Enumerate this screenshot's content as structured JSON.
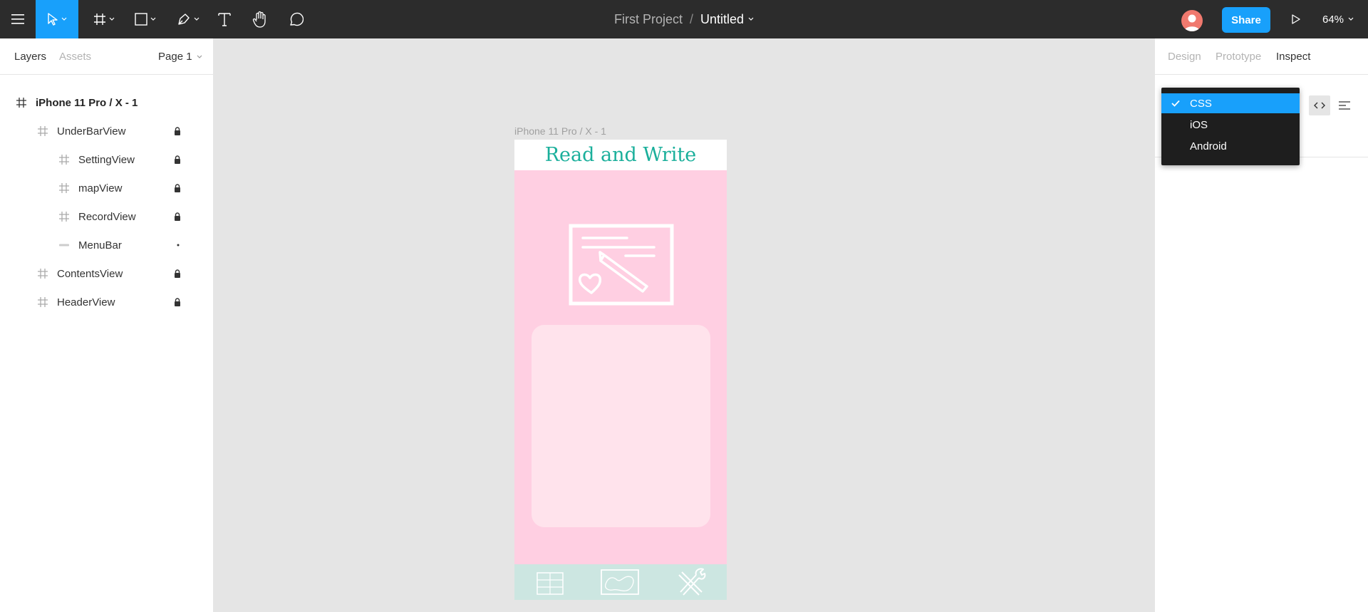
{
  "toolbar": {
    "project_name": "First Project",
    "separator": "/",
    "file_name": "Untitled",
    "share_label": "Share",
    "zoom": "64%",
    "tools": [
      "menu-icon",
      "move-tool-icon",
      "frame-tool-icon",
      "shape-tool-icon",
      "pen-tool-icon",
      "text-tool-icon",
      "hand-tool-icon",
      "comment-tool-icon"
    ]
  },
  "left_panel": {
    "tabs": [
      "Layers",
      "Assets"
    ],
    "page": "Page 1",
    "layers": [
      {
        "name": "iPhone 11 Pro / X - 1",
        "depth": 0,
        "type": "frame",
        "locked": false,
        "bold": true
      },
      {
        "name": "UnderBarView",
        "depth": 1,
        "type": "frame",
        "locked": true
      },
      {
        "name": "SettingView",
        "depth": 2,
        "type": "frame",
        "locked": true
      },
      {
        "name": "mapView",
        "depth": 2,
        "type": "frame",
        "locked": true
      },
      {
        "name": "RecordView",
        "depth": 2,
        "type": "frame",
        "locked": true
      },
      {
        "name": "MenuBar",
        "depth": 2,
        "type": "rect",
        "locked": false
      },
      {
        "name": "ContentsView",
        "depth": 1,
        "type": "frame",
        "locked": true
      },
      {
        "name": "HeaderView",
        "depth": 1,
        "type": "frame",
        "locked": true
      }
    ]
  },
  "right_panel": {
    "tabs": [
      "Design",
      "Prototype",
      "Inspect"
    ],
    "active_tab": "Inspect",
    "code_options": [
      "CSS",
      "iOS",
      "Android"
    ],
    "selected_option": "CSS"
  },
  "canvas": {
    "frame_label": "iPhone 11 Pro / X - 1",
    "header_text": "Read and Write"
  },
  "colors": {
    "toolbar_bg": "#2c2c2c",
    "accent": "#18a0fb",
    "header_text": "#1aaf9b",
    "phone_bg": "#ffcfe2",
    "content_box": "#ffe3ec",
    "underbar": "#cce6e1"
  }
}
